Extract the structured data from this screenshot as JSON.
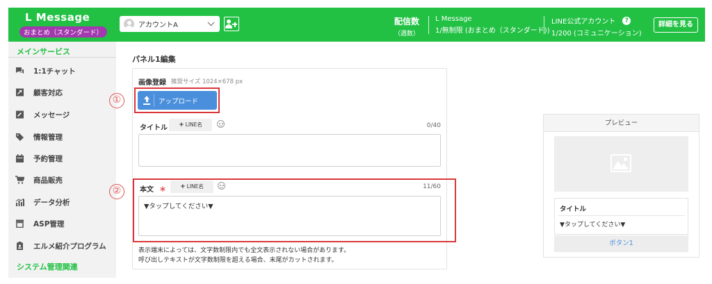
{
  "header": {
    "brand": "L Message",
    "plan_badge": "おまとめ（スタンダード）",
    "account_name": "アカウントA",
    "delivery_label": "配信数",
    "delivery_sub": "（週数）",
    "lmessage_label": "L Message",
    "lmessage_value": "1/無制限 (おまとめ（スタンダード))",
    "line_label": "LINE公式アカウント",
    "line_value": "1/200 (コミュニケーション)",
    "help_icon": "?",
    "details_button": "詳細を見る"
  },
  "sidebar": {
    "section_main": "メインサービス",
    "section_system": "システム管理関連",
    "items": [
      {
        "label": "1:1チャット",
        "icon": "chat-icon"
      },
      {
        "label": "顧客対応",
        "icon": "customer-icon"
      },
      {
        "label": "メッセージ",
        "icon": "message-icon"
      },
      {
        "label": "情報管理",
        "icon": "tag-icon"
      },
      {
        "label": "予約管理",
        "icon": "calendar-icon"
      },
      {
        "label": "商品販売",
        "icon": "cart-icon"
      },
      {
        "label": "データ分析",
        "icon": "chart-icon"
      },
      {
        "label": "ASP管理",
        "icon": "asp-icon"
      },
      {
        "label": "エルメ紹介プログラム",
        "icon": "badge-icon"
      }
    ]
  },
  "main": {
    "panel_title": "パネル1編集",
    "image_label": "画像登録",
    "image_hint": "推奨サイズ 1024×678 px",
    "upload_button": "アップロード",
    "title_label": "タイトル",
    "line_name_button": "LINE名",
    "title_counter": "0/40",
    "title_value": "",
    "body_label": "本文",
    "required_mark": "＊",
    "body_counter": "11/60",
    "body_value": "▼タップしてください▼",
    "note_line1": "表示端末によっては、文字数制限内でも全文表示されない場合があります。",
    "note_line2": "呼び出しテキストが文字数制限を超える場合、末尾がカットされます。",
    "annotation_1": "①",
    "annotation_2": "②"
  },
  "preview": {
    "header": "プレビュー",
    "card_title": "タイトル",
    "card_text": "▼タップしてください▼",
    "button_label": "ボタン1"
  },
  "colors": {
    "brand_green": "#22c144",
    "badge_purple": "#a239ae",
    "upload_blue": "#4a8fdc",
    "annotation_red": "#d9353a"
  }
}
